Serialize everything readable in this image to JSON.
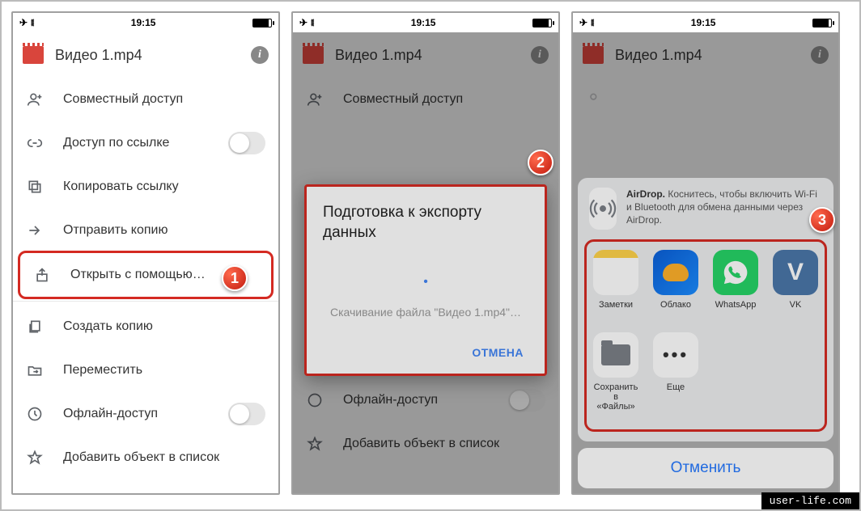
{
  "status_bar": {
    "time": "19:15"
  },
  "header": {
    "title": "Видео 1.mp4"
  },
  "menu": {
    "share_access": "Совместный доступ",
    "link_access": "Доступ по ссылке",
    "copy_link": "Копировать ссылку",
    "send_copy": "Отправить копию",
    "open_with": "Открыть с помощью…",
    "make_copy": "Создать копию",
    "move": "Переместить",
    "offline": "Офлайн-доступ",
    "add_to_list": "Добавить объект в список"
  },
  "dialog": {
    "title": "Подготовка к экспорту данных",
    "subtitle": "Скачивание файла \"Видео 1.mp4\"…",
    "cancel": "ОТМЕНА"
  },
  "share_sheet": {
    "airdrop_bold": "AirDrop.",
    "airdrop_rest": " Коснитесь, чтобы включить Wi-Fi и Bluetooth для обмена данными через AirDrop.",
    "apps": {
      "notes": "Заметки",
      "cloud": "Облако",
      "whatsapp": "WhatsApp",
      "vk": "VK",
      "files_line1": "Сохранить в",
      "files_line2": "«Файлы»",
      "more": "Еще"
    },
    "cancel": "Отменить"
  },
  "badges": {
    "one": "1",
    "two": "2",
    "three": "3"
  },
  "watermark": "user-life.com"
}
